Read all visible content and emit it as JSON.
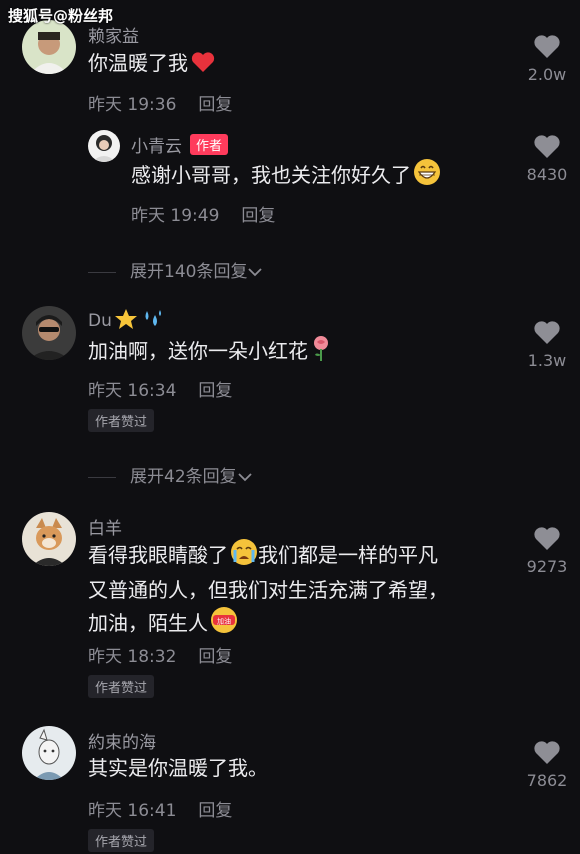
{
  "watermark": "搜狐号@粉丝邦",
  "comments": [
    {
      "name": "赖家益",
      "text": "你温暖了我",
      "time": "昨天 19:36",
      "reply_label": "回复",
      "likes": "2.0w",
      "reply": {
        "name": "小青云",
        "badge": "作者",
        "text": "感谢小哥哥，我也关注你好久了",
        "time": "昨天 19:49",
        "reply_label": "回复",
        "likes": "8430"
      },
      "expand": "展开140条回复"
    },
    {
      "name": "Du",
      "text": "加油啊，送你一朵小红花",
      "time": "昨天 16:34",
      "reply_label": "回复",
      "likes": "1.3w",
      "tag": "作者赞过",
      "expand": "展开42条回复"
    },
    {
      "name": "白羊",
      "text_line1a": "看得我眼睛酸了",
      "text_line1b": "我们都是一样的平凡",
      "text_line2": "又普通的人，但我们对生活充满了希望，",
      "text_line3": "加油，陌生人",
      "emoji_label": "加油",
      "time": "昨天 18:32",
      "reply_label": "回复",
      "likes": "9273",
      "tag": "作者赞过"
    },
    {
      "name": "約束的海",
      "text": "其实是你温暖了我。",
      "time": "昨天 16:41",
      "reply_label": "回复",
      "likes": "7862",
      "tag": "作者赞过"
    }
  ],
  "colors": {
    "background": "#0f0f12",
    "author_badge": "#ff3b5c",
    "secondary_text": "#8c8c94"
  }
}
